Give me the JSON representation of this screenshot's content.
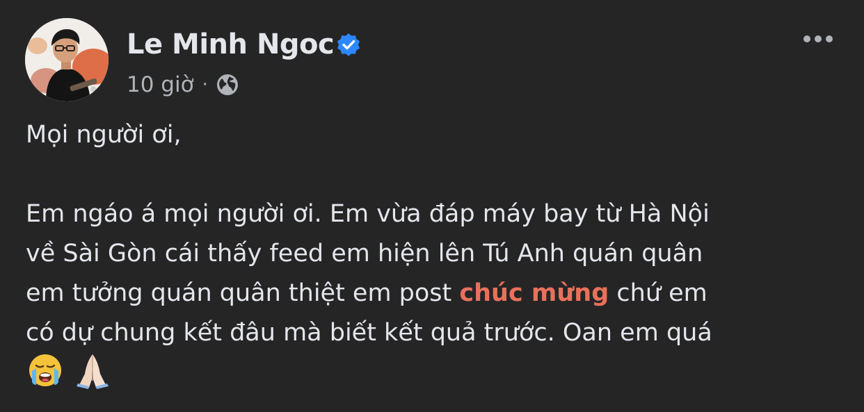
{
  "post": {
    "author": "Le Minh Ngoc",
    "verified": true,
    "time": "10 giờ",
    "separator": "·",
    "audience_icon": "globe-icon",
    "more_icon": "more-options-icon",
    "greeting": "Mọi người ơi,",
    "lines": {
      "line1": "Em ngáo á mọi người ơi. Em vừa đáp máy bay từ Hà Nội",
      "line2": "về Sài Gòn cái thấy feed em hiện lên Tú Anh quán quân",
      "line3_before": "em tưởng quán quân thiệt em post ",
      "line3_highlight": "chúc mừng",
      "line3_after": " chứ em",
      "line4": "có dự chung kết đâu mà biết kết quả trước. Oan em quá"
    },
    "emojis": [
      "loudly-crying-face-icon",
      "folded-hands-icon"
    ]
  },
  "colors": {
    "background": "#252526",
    "text_primary": "#e4e6eb",
    "text_secondary": "#b0b3b8",
    "highlight": "#e9715b",
    "verified_badge": "#2d88ff"
  }
}
